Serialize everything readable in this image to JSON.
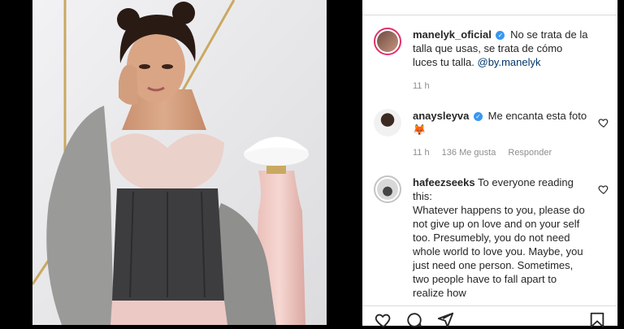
{
  "post": {
    "caption": {
      "username": "manelyk_oficial",
      "text": "No se trata de la talla que usas, se trata de cómo luces tu talla.",
      "mention": "@by.manelyk",
      "time": "11 h"
    },
    "comments": [
      {
        "username": "anaysleyva",
        "verified": true,
        "text": "Me encanta esta foto 🦊",
        "time": "11 h",
        "likes": "136 Me gusta",
        "reply": "Responder"
      },
      {
        "username": "hafeezseeks",
        "verified": false,
        "text": "To everyone reading this:\nWhatever happens to you, please do not give up on love and on your self too. Presumebly, you do not need whole world to love you. Maybe, you just need one person. Sometimes, two people have to fall apart to realize how"
      }
    ]
  },
  "icons": {
    "like": "heart-icon",
    "comment": "comment-icon",
    "share": "send-icon",
    "save": "bookmark-icon",
    "verified": "verified-badge-icon"
  },
  "colors": {
    "verified": "#3897f0",
    "mention": "#00376b",
    "meta": "#8e8e8e"
  }
}
